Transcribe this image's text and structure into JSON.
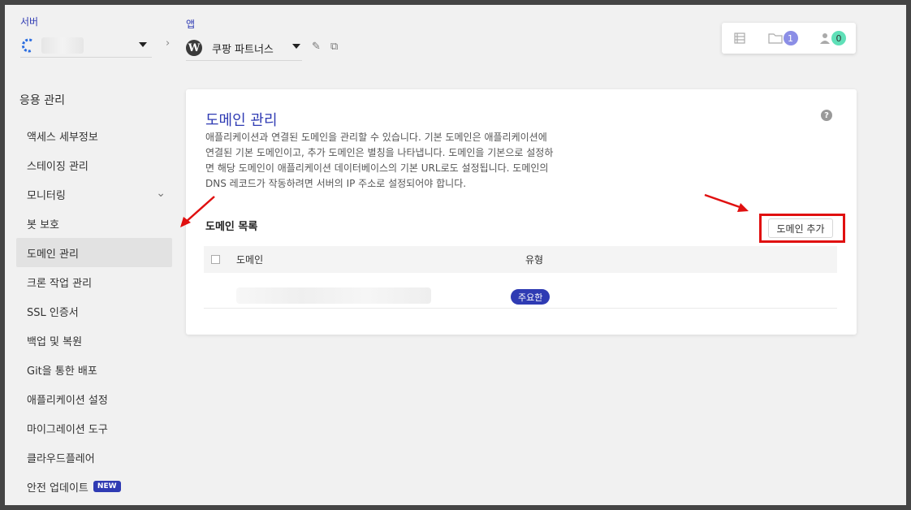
{
  "server": {
    "label": "서버"
  },
  "breadcrumb_sep": "›",
  "app": {
    "label": "앱",
    "name": "쿠팡 파트너스",
    "icon": "wordpress-icon"
  },
  "topright": {
    "items": [
      {
        "icon": "list-icon"
      },
      {
        "icon": "folder-icon",
        "count": "1"
      },
      {
        "icon": "user-icon",
        "count": "0"
      }
    ]
  },
  "sidebar": {
    "title": "응용 관리",
    "items": [
      {
        "label": "액세스 세부정보"
      },
      {
        "label": "스테이징 관리"
      },
      {
        "label": "모니터링"
      },
      {
        "label": "봇 보호"
      },
      {
        "label": "도메인 관리"
      },
      {
        "label": "크론 작업 관리"
      },
      {
        "label": "SSL 인증서"
      },
      {
        "label": "백업 및 복원"
      },
      {
        "label": "Git을 통한 배포"
      },
      {
        "label": "애플리케이션 설정"
      },
      {
        "label": "마이그레이션 도구"
      },
      {
        "label": "클라우드플레어"
      },
      {
        "label": "안전 업데이트",
        "badge": "NEW"
      }
    ]
  },
  "main": {
    "title": "도메인 관리",
    "description_lines": [
      "애플리케이션과 연결된 도메인을 관리할 수 있습니다. 기본 도메인은 애플리케이션에",
      "연결된 기본 도메인이고, 추가 도메인은 별칭을 나타냅니다. 도메인을 기본으로 설정하",
      "면 해당 도메인이 애플리케이션 데이터베이스의 기본 URL로도 설정됩니다. 도메인의",
      "DNS 레코드가 작동하려면 서버의 IP 주소로 설정되어야 합니다."
    ],
    "list_title": "도메인 목록",
    "add_button": "도메인 추가",
    "table": {
      "columns": [
        "도메인",
        "유형"
      ],
      "rows": [
        {
          "type_badge": "주요한"
        }
      ]
    }
  },
  "colors": {
    "accent": "#2f3bb3",
    "highlight": "#e01010"
  }
}
